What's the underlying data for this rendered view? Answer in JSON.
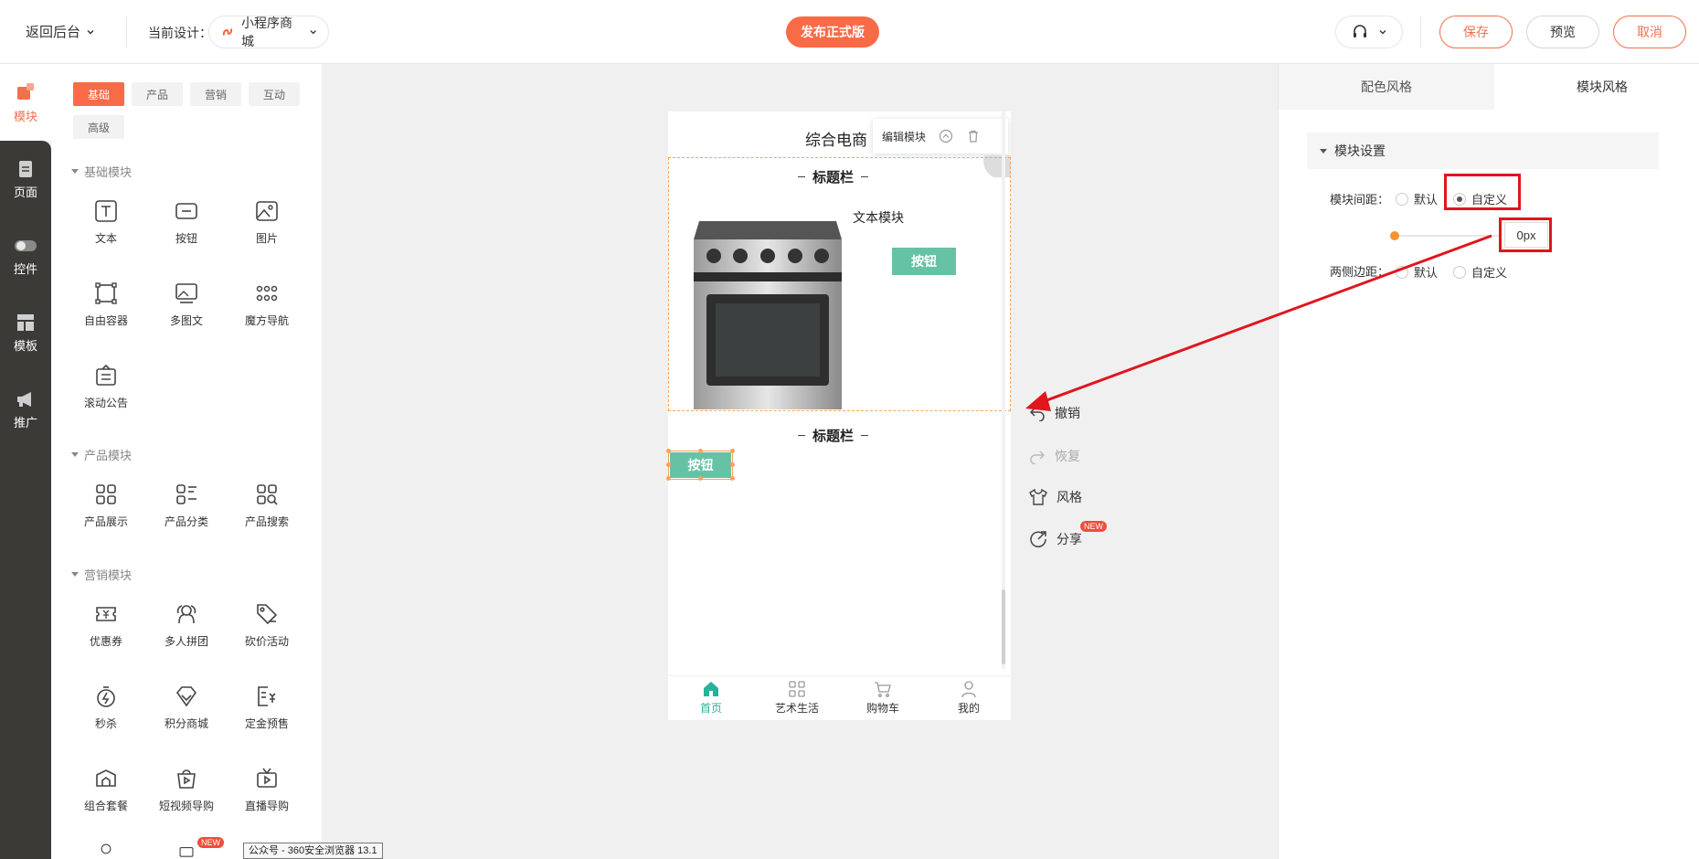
{
  "header": {
    "back_label": "返回后台",
    "current_design_label": "当前设计：",
    "current_design_value": "小程序商城",
    "publish_label": "发布正式版",
    "save_label": "保存",
    "preview_label": "预览",
    "cancel_label": "取消"
  },
  "rail": {
    "items": [
      {
        "label": "模块",
        "icon": "module-icon"
      },
      {
        "label": "页面",
        "icon": "page-icon"
      },
      {
        "label": "控件",
        "icon": "toggle-icon"
      },
      {
        "label": "模板",
        "icon": "template-icon"
      },
      {
        "label": "推广",
        "icon": "megaphone-icon"
      }
    ]
  },
  "panel": {
    "tags": [
      "基础",
      "产品",
      "营销",
      "互动",
      "高级"
    ],
    "groups": [
      {
        "title": "基础模块",
        "items": [
          "文本",
          "按钮",
          "图片",
          "自由容器",
          "多图文",
          "魔方导航",
          "滚动公告"
        ]
      },
      {
        "title": "产品模块",
        "items": [
          "产品展示",
          "产品分类",
          "产品搜索"
        ]
      },
      {
        "title": "营销模块",
        "items": [
          "优惠券",
          "多人拼团",
          "砍价活动",
          "秒杀",
          "积分商城",
          "定金预售",
          "组合套餐",
          "短视频导购",
          "直播导购"
        ]
      }
    ],
    "new_badge": "NEW",
    "tooltip": "公众号 - 360安全浏览器 13.1"
  },
  "canvas": {
    "page_title": "综合电商",
    "edit_module_label": "编辑模块",
    "section_title_1": "标题栏",
    "section_title_2": "标题栏",
    "text_module": "文本模块",
    "button_1": "按钮",
    "button_2": "按钮",
    "tabbar": [
      "首页",
      "艺术生活",
      "购物车",
      "我的"
    ]
  },
  "tools": {
    "undo": "撤销",
    "redo": "恢复",
    "style": "风格",
    "share": "分享",
    "share_badge": "NEW"
  },
  "right_panel": {
    "tab_color": "配色风格",
    "tab_module": "模块风格",
    "section_title": "模块设置",
    "spacing_label": "模块间距：",
    "spacing_default": "默认",
    "spacing_custom": "自定义",
    "spacing_value": "0px",
    "side_margin_label": "两侧边距：",
    "side_default": "默认",
    "side_custom": "自定义"
  },
  "colors": {
    "accent": "#f96a47",
    "highlight": "#e0151d",
    "button_green": "#66c2a5",
    "tab_active": "#27b39b"
  }
}
